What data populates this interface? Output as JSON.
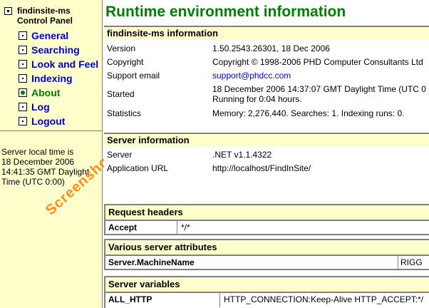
{
  "sidebar": {
    "brand_title": "findinsite-ms",
    "brand_subtitle": "Control Panel",
    "nav": [
      {
        "label": "General",
        "active": false
      },
      {
        "label": "Searching",
        "active": false
      },
      {
        "label": "Look and Feel",
        "active": false
      },
      {
        "label": "Indexing",
        "active": false
      },
      {
        "label": "About",
        "active": true
      },
      {
        "label": "Log",
        "active": false
      },
      {
        "label": "Logout",
        "active": false
      }
    ],
    "server_time_label": "Server local time is",
    "server_time_line1": "18 December 2006",
    "server_time_line2": "14:41:35 GMT Daylight",
    "server_time_line3": "Time (UTC 0:00)"
  },
  "watermark": "Screenshot",
  "main": {
    "title": "Runtime environment information",
    "info": {
      "heading": "findinsite-ms information",
      "rows": [
        {
          "key": "Version",
          "value": "1.50.2543.26301, 18 Dec 2006"
        },
        {
          "key": "Copyright",
          "value": "Copyright © 1998-2006 PHD Computer Consultants Ltd"
        },
        {
          "key": "Support email",
          "value": "support@phdcc.com"
        },
        {
          "key": "Started",
          "value": "18 December 2006 14:37:07 GMT Daylight Time (UTC 0",
          "value2": "Running for 0:04 hours."
        },
        {
          "key": "Statistics",
          "value": "Memory: 2,276,440.  Searches: 1.  Indexing runs: 0."
        }
      ]
    },
    "server": {
      "heading": "Server information",
      "rows": [
        {
          "key": "Server",
          "value": ".NET v1.1.4322"
        },
        {
          "key": "Application URL",
          "value": "http://localhost/FindInSite/"
        }
      ]
    },
    "request_headers": {
      "heading": "Request headers",
      "key": "Accept",
      "value": "*/*"
    },
    "server_attributes": {
      "heading": "Various server attributes",
      "key": "Server.MachineName",
      "value": "RIGG"
    },
    "server_variables": {
      "heading": "Server variables",
      "key": "ALL_HTTP",
      "value": "HTTP_CONNECTION:Keep-Alive HTTP_ACCEPT:*/"
    }
  },
  "colors": {
    "title": "#008000",
    "link": "#0000cc",
    "panel": "#ffffcc",
    "watermark": "#ff8c1a"
  }
}
